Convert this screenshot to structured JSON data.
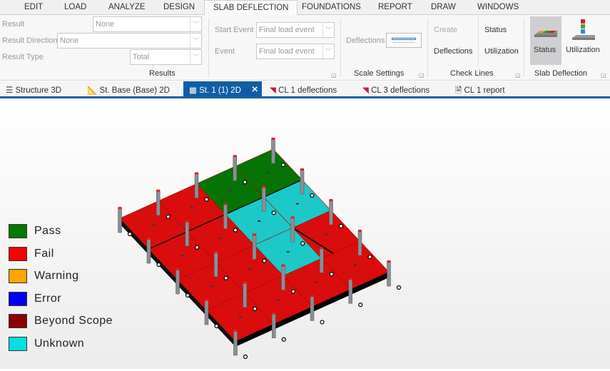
{
  "menu": [
    "EDIT",
    "LOAD",
    "ANALYZE",
    "DESIGN",
    "SLAB DEFLECTION",
    "FOUNDATIONS",
    "REPORT",
    "DRAW",
    "WINDOWS"
  ],
  "results": {
    "result_label": "Result",
    "result_value": "None",
    "direction_label": "Result Direction",
    "direction_value": "None",
    "type_label": "Result Type",
    "type_value": "Total",
    "group": "Results"
  },
  "events": {
    "start_label": "Start Event",
    "start_value": "Final load event",
    "event_label": "Event",
    "event_value": "Final load event"
  },
  "scale": {
    "deflections_label": "Deflections",
    "group": "Scale Settings"
  },
  "check_lines": {
    "create": "Create",
    "deflections": "Deflections",
    "status": "Status",
    "utilization": "Utilization",
    "group": "Check Lines"
  },
  "slab_deflection": {
    "status": "Status",
    "utilization": "Utilization",
    "group": "Slab Deflection"
  },
  "tabs": [
    "Structure 3D",
    "St. Base (Base) 2D",
    "St. 1 (1) 2D",
    "CL 1 deflections",
    "CL 3 deflections",
    "CL 1 report"
  ],
  "legend": [
    {
      "label": "Pass",
      "color": "#007a00"
    },
    {
      "label": "Fail",
      "color": "#ff0000"
    },
    {
      "label": "Warning",
      "color": "#ffa500"
    },
    {
      "label": "Error",
      "color": "#0000ff"
    },
    {
      "label": "Beyond Scope",
      "color": "#8b0000"
    },
    {
      "label": "Unknown",
      "color": "#00e0e0"
    }
  ],
  "slab_cells": [
    [
      "fail",
      "fail",
      "pass",
      "pass"
    ],
    [
      "fail",
      "fail",
      "unknown",
      "unknown"
    ],
    [
      "fail",
      "fail",
      "unknown",
      "fail"
    ],
    [
      "fail",
      "fail",
      "fail",
      "fail"
    ]
  ],
  "cell_colors": {
    "pass": "#067306",
    "fail": "#d90d0d",
    "unknown": "#1cc8c8"
  }
}
